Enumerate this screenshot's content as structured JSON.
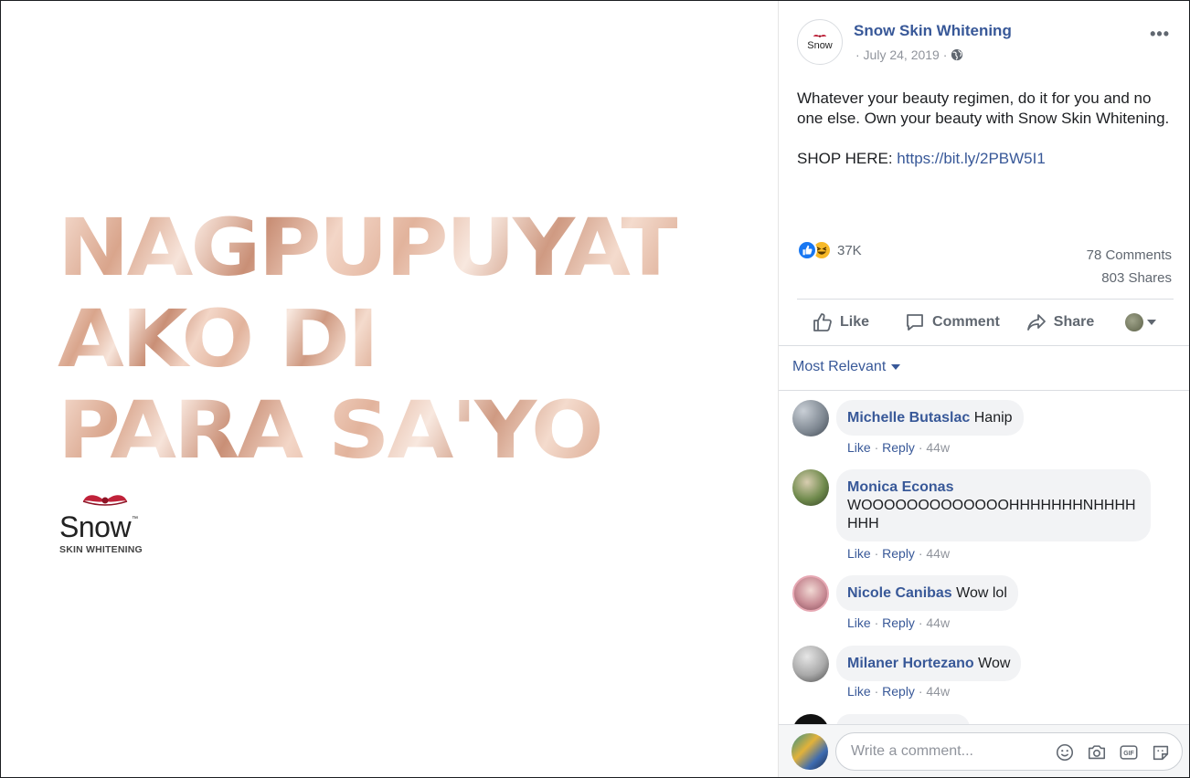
{
  "image": {
    "headline_lines": [
      "NAGPUPUYAT",
      "AKO DI",
      "PARA SA'YO"
    ],
    "logo_word": "Snow",
    "logo_tm": "™",
    "logo_subtitle": "SKIN WHITENING"
  },
  "post": {
    "page_name": "Snow Skin Whitening",
    "avatar_text": "Snow",
    "date": "· July 24, 2019 ·",
    "text_line1": "Whatever your beauty regimen, do it for you and no one else. Own your beauty with Snow Skin Whitening.",
    "shop_label": "SHOP HERE:",
    "shop_link": "https://bit.ly/2PBW5I1",
    "more_label": "•••"
  },
  "reactions": {
    "count": "37K",
    "comments": "78 Comments",
    "shares": "803 Shares"
  },
  "actions": {
    "like": "Like",
    "comment": "Comment",
    "share": "Share"
  },
  "sort_label": "Most Relevant",
  "comments": [
    {
      "name": "Michelle Butaslac",
      "text": "Hanip",
      "like": "Like",
      "reply": "Reply",
      "time": "44w"
    },
    {
      "name": "Monica Econas",
      "text": "WOOOOOOOOOOOOOHHHHHHHNHHHHHHH",
      "like": "Like",
      "reply": "Reply",
      "time": "44w"
    },
    {
      "name": "Nicole Canibas",
      "text": "Wow lol",
      "like": "Like",
      "reply": "Reply",
      "time": "44w"
    },
    {
      "name": "Milaner Hortezano",
      "text": "Wow",
      "like": "Like",
      "reply": "Reply",
      "time": "44w"
    }
  ],
  "composer": {
    "placeholder": "Write a comment..."
  },
  "colors": {
    "link_blue": "#385898",
    "like_blue": "#1877f2",
    "haha_yellow": "#f7b928",
    "bow_red": "#c0223a"
  }
}
